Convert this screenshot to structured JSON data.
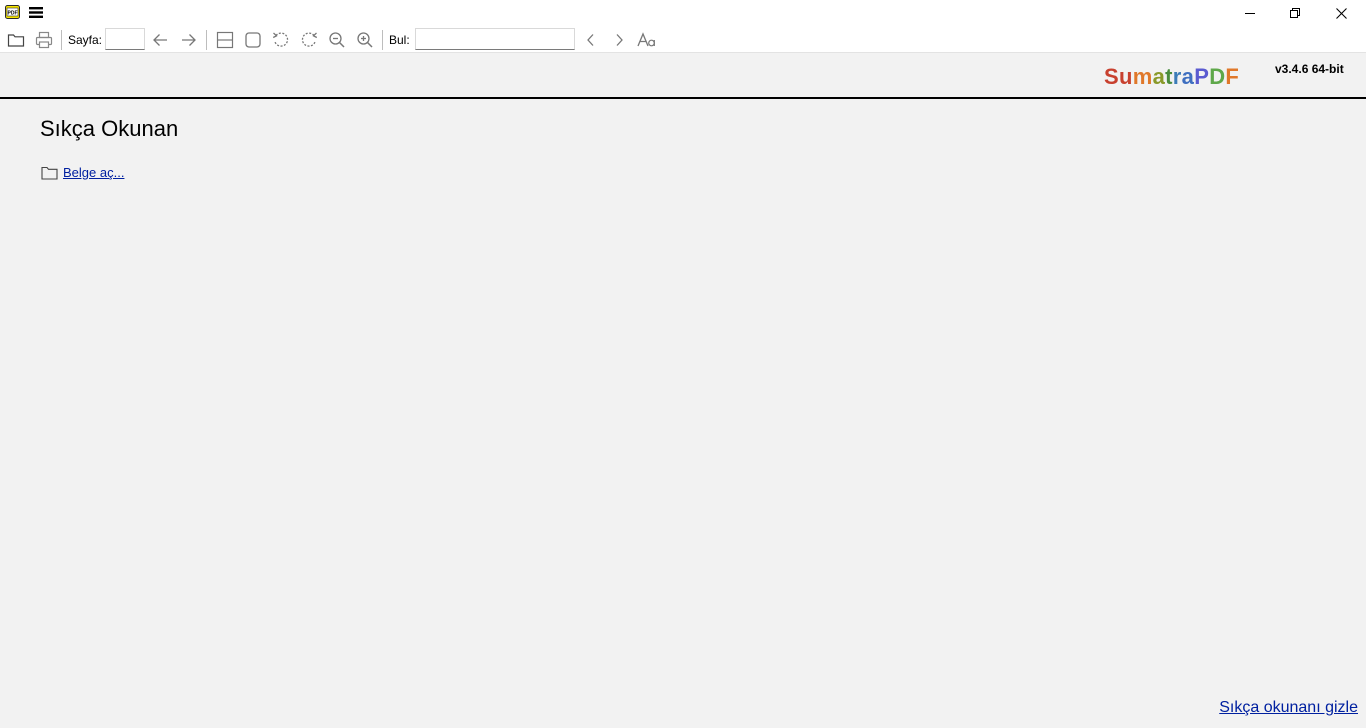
{
  "titlebar": {
    "app_icon_text": "PDF",
    "icons": {
      "menu": "hamburger-menu-icon",
      "minimize": "minimize-icon",
      "restore": "restore-icon",
      "close": "close-icon"
    }
  },
  "toolbar": {
    "page_label": "Sayfa:",
    "page_value": "",
    "find_label": "Bul:",
    "find_value": ""
  },
  "header": {
    "logo_letters": [
      {
        "ch": "S",
        "color": "#c8412f"
      },
      {
        "ch": "u",
        "color": "#c8412f"
      },
      {
        "ch": "m",
        "color": "#e0782a"
      },
      {
        "ch": "a",
        "color": "#8a9a2a"
      },
      {
        "ch": "t",
        "color": "#4a8c3c"
      },
      {
        "ch": "r",
        "color": "#3c7cb8"
      },
      {
        "ch": "a",
        "color": "#3f6fc0"
      },
      {
        "ch": "P",
        "color": "#5a5ad0"
      },
      {
        "ch": "D",
        "color": "#5fa84a"
      },
      {
        "ch": "F",
        "color": "#e0782a"
      }
    ],
    "version": "v3.4.6 64-bit"
  },
  "main": {
    "title": "Sıkça Okunan",
    "open_document": "Belge aç...",
    "hide_frequent": "Sıkça okunanı gizle"
  }
}
